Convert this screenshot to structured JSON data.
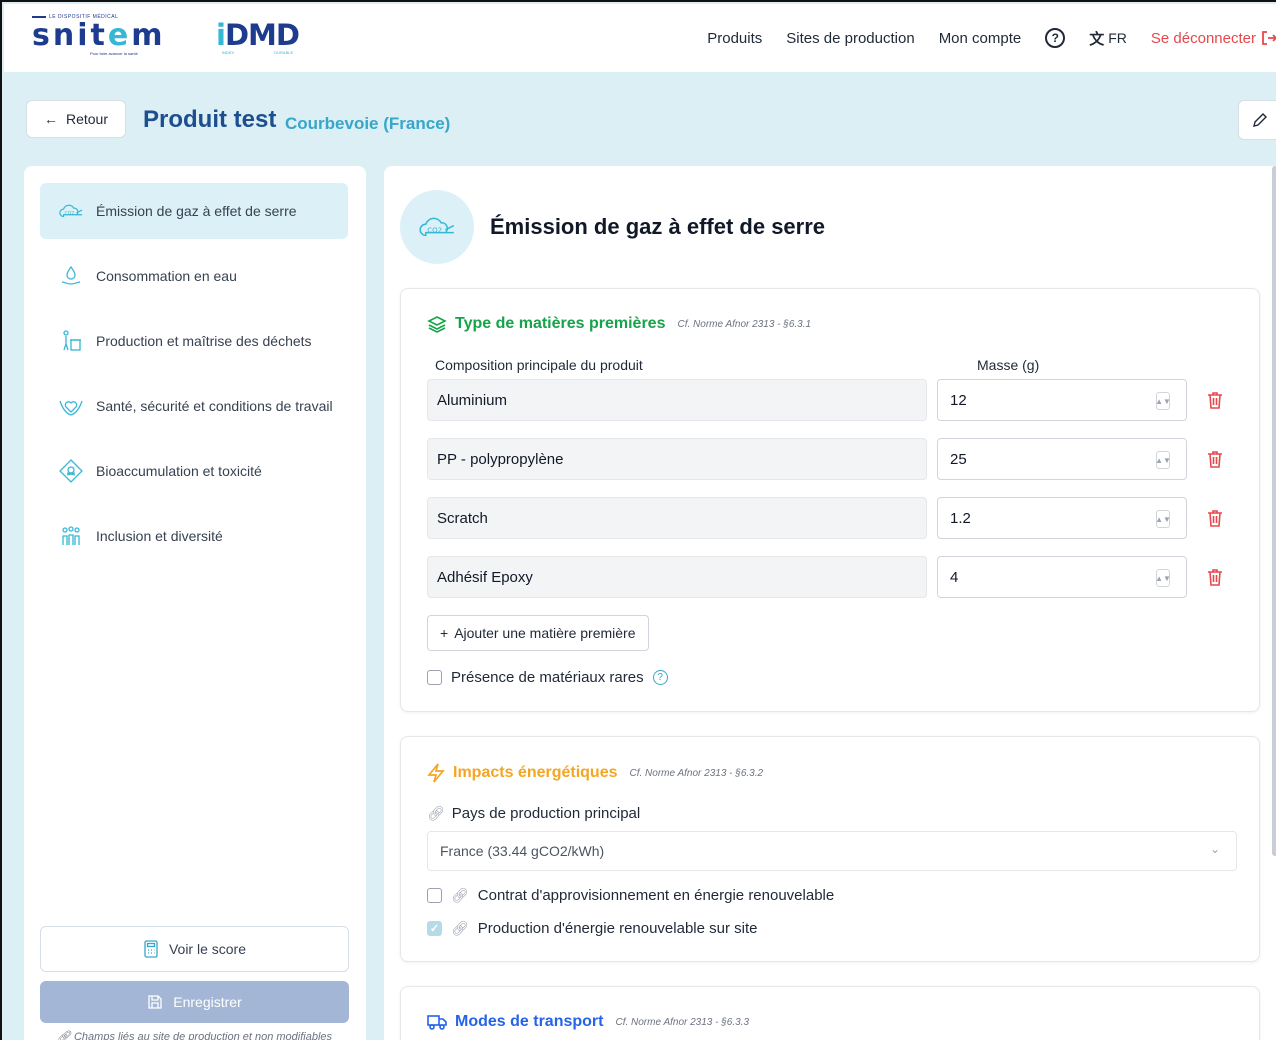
{
  "header": {
    "logo_snitem": {
      "tagline": "LE DISPOSITIF MÉDICAL",
      "word": "snitem",
      "sub": "Pour faire avancer la santé"
    },
    "logo_idmd": {
      "word": "iDMD",
      "left_tag": "INDEX",
      "right_tag": "DURABLE"
    },
    "nav": {
      "products": "Produits",
      "sites": "Sites de production",
      "account": "Mon compte",
      "help": "?",
      "lang": "FR",
      "logout": "Se déconnecter"
    }
  },
  "subheader": {
    "back_label": "Retour",
    "title": "Produit test",
    "subtitle": "Courbevoie (France)"
  },
  "sidebar": {
    "items": [
      {
        "label": "Émission de gaz à effet de serre",
        "icon": "co2-cloud-icon",
        "active": true
      },
      {
        "label": "Consommation en eau",
        "icon": "water-hand-icon",
        "active": false
      },
      {
        "label": "Production et maîtrise des déchets",
        "icon": "waste-bin-icon",
        "active": false
      },
      {
        "label": "Santé, sécurité et conditions de travail",
        "icon": "heart-hands-icon",
        "active": false
      },
      {
        "label": "Bioaccumulation et toxicité",
        "icon": "toxic-icon",
        "active": false
      },
      {
        "label": "Inclusion et diversité",
        "icon": "people-group-icon",
        "active": false
      }
    ],
    "score_label": "Voir le score",
    "save_label": "Enregistrer",
    "footnote": "Champs liés au site de production et non modifiables"
  },
  "main": {
    "title": "Émission de gaz à effet de serre",
    "raw_materials": {
      "title": "Type de matières premières",
      "ref": "Cf. Norme Afnor 2313 - §6.3.1",
      "col_material": "Composition principale du produit",
      "col_mass": "Masse (g)",
      "rows": [
        {
          "material": "Aluminium",
          "mass": "12"
        },
        {
          "material": "PP - polypropylène",
          "mass": "25"
        },
        {
          "material": "Scratch",
          "mass": "1.2"
        },
        {
          "material": "Adhésif Epoxy",
          "mass": "4"
        }
      ],
      "add_label": "Ajouter une matière première",
      "rare_label": "Présence de matériaux rares",
      "rare_checked": false
    },
    "energy": {
      "title": "Impacts énergétiques",
      "ref": "Cf. Norme Afnor 2313 - §6.3.2",
      "country_label": "Pays de production principal",
      "country_value": "France (33.44 gCO2/kWh)",
      "contract_label": "Contrat d'approvisionnement en énergie renouvelable",
      "contract_checked": false,
      "onsite_label": "Production d'énergie renouvelable sur site",
      "onsite_checked": true
    },
    "transport": {
      "title": "Modes de transport",
      "ref": "Cf. Norme Afnor 2313 - §6.3.3"
    }
  },
  "colors": {
    "teal": "#37b7d6",
    "navy": "#1d3b8f",
    "green": "#16a34a",
    "orange": "#f5a524",
    "blue": "#2563eb",
    "red": "#e5484d"
  }
}
